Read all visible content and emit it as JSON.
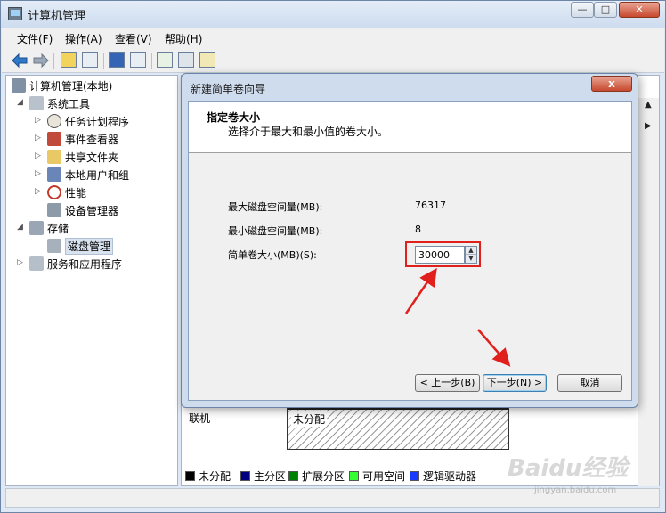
{
  "window": {
    "title": "计算机管理"
  },
  "menu": [
    "文件(F)",
    "操作(A)",
    "查看(V)",
    "帮助(H)"
  ],
  "tree": [
    {
      "label": "计算机管理(本地)",
      "icon": "computer-icon",
      "arrow": ""
    },
    {
      "label": "系统工具",
      "icon": "tools-icon",
      "arrow": "◢"
    },
    {
      "label": "任务计划程序",
      "icon": "clock-icon",
      "arrow": "▷"
    },
    {
      "label": "事件查看器",
      "icon": "event-viewer-icon",
      "arrow": "▷"
    },
    {
      "label": "共享文件夹",
      "icon": "shared-folder-icon",
      "arrow": "▷"
    },
    {
      "label": "本地用户和组",
      "icon": "users-icon",
      "arrow": "▷"
    },
    {
      "label": "性能",
      "icon": "performance-icon",
      "arrow": "▷"
    },
    {
      "label": "设备管理器",
      "icon": "device-manager-icon",
      "arrow": ""
    },
    {
      "label": "存储",
      "icon": "storage-icon",
      "arrow": "◢"
    },
    {
      "label": "磁盘管理",
      "icon": "disk-icon",
      "arrow": ""
    },
    {
      "label": "服务和应用程序",
      "icon": "services-icon",
      "arrow": "▷"
    }
  ],
  "disk": {
    "status": "联机",
    "partition_label": "未分配"
  },
  "legend": [
    {
      "label": "未分配",
      "color": "#000000"
    },
    {
      "label": "主分区",
      "color": "#000080"
    },
    {
      "label": "扩展分区",
      "color": "#008000"
    },
    {
      "label": "可用空间",
      "color": "#33ff33"
    },
    {
      "label": "逻辑驱动器",
      "color": "#1a3aff"
    }
  ],
  "dialog": {
    "title": "新建简单卷向导",
    "close_label": "x",
    "heading": "指定卷大小",
    "subheading": "选择介于最大和最小值的卷大小。",
    "max_label": "最大磁盘空间量(MB):",
    "max_value": "76317",
    "min_label": "最小磁盘空间量(MB):",
    "min_value": "8",
    "size_label": "简单卷大小(MB)(S):",
    "size_value": "30000",
    "back_button": "< 上一步(B)",
    "next_button": "下一步(N) >",
    "cancel_button": "取消"
  },
  "watermark": {
    "text": "Baidu经验",
    "sub": "jingyan.baidu.com"
  },
  "colors": {
    "highlight": "#e0201d"
  }
}
